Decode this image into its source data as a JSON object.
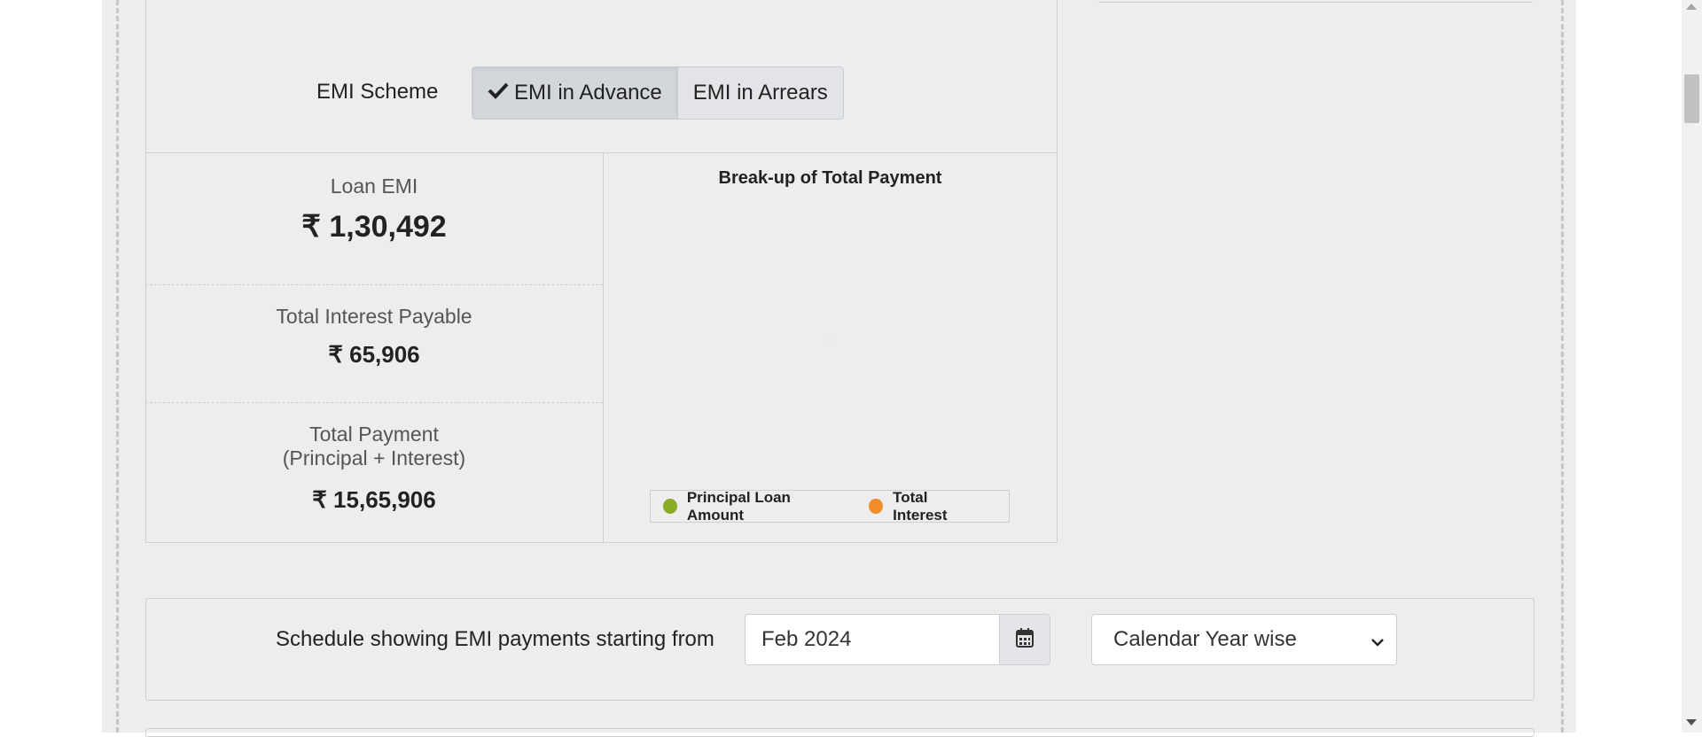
{
  "emi_scheme": {
    "label": "EMI Scheme",
    "options": [
      "EMI in Advance",
      "EMI in Arrears"
    ],
    "selected": "EMI in Advance"
  },
  "results": {
    "loan_emi_label": "Loan EMI",
    "loan_emi_value": "₹ 1,30,492",
    "interest_label": "Total Interest Payable",
    "interest_value": "₹ 65,906",
    "total_label_line1": "Total Payment",
    "total_label_line2": "(Principal + Interest)",
    "total_value": "₹ 15,65,906"
  },
  "chart": {
    "title": "Break-up of Total Payment",
    "legend": [
      {
        "label": "Principal Loan Amount",
        "color": "#8aac26"
      },
      {
        "label": "Total Interest",
        "color": "#f28c28"
      }
    ]
  },
  "schedule": {
    "label": "Schedule showing EMI payments starting from",
    "start_value": "Feb 2024",
    "view_selected": "Calendar Year wise"
  },
  "icons": {
    "check": "check-icon",
    "calendar": "calendar-icon",
    "chevron": "chevron-down-icon"
  }
}
